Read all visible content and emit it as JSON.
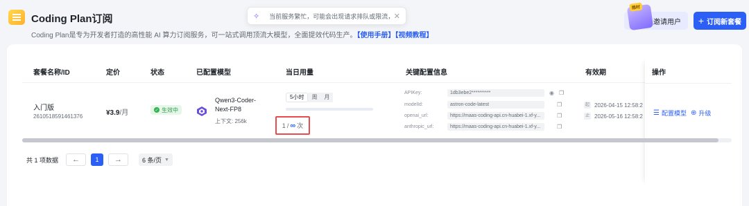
{
  "header": {
    "title": "Coding Plan订阅",
    "subtitle": "Coding Plan是专为开发者打造的高性能 AI 算力订阅服务，可一站式调用顶流大模型，全面提效代码生产。",
    "link_manual": "【使用手册】",
    "link_video": "【视频教程】",
    "invite_label": "邀请用户",
    "invite_badge": "限时",
    "subscribe_label": "订阅新套餐"
  },
  "toast": {
    "message": "当前服务繁忙，可能会出现请求排队或限流，GLM-"
  },
  "table": {
    "headers": [
      "套餐名称/ID",
      "定价",
      "状态",
      "已配置模型",
      "当日用量",
      "关键配置信息",
      "有效期",
      "操作"
    ],
    "row": {
      "name": "入门版",
      "id": "2610518591461376",
      "price": "¥3.9",
      "price_unit": "/月",
      "status": "生效中",
      "model_name": "Qwen3-Coder-Next-FP8",
      "model_context": "上下文: 256k",
      "usage_tabs": [
        "5小时",
        "周",
        "月"
      ],
      "usage_active_tab": "5小时",
      "usage_fraction": 0,
      "usage_count": "1",
      "usage_sep": "/",
      "usage_limit_symbol": "∞",
      "usage_unit": "次",
      "config": [
        {
          "key": "APIKey:",
          "value": "1db3ebe2**********",
          "icons": [
            "eye-icon",
            "copy-icon"
          ]
        },
        {
          "key": "modelId:",
          "value": "astron-code-latest",
          "icons": [
            "copy-icon"
          ]
        },
        {
          "key": "openai_url:",
          "value": "https://maas-coding-api.cn-huabei-1.xf-y...",
          "icons": [
            "copy-icon"
          ]
        },
        {
          "key": "anthropic_url:",
          "value": "https://maas-coding-api.cn-huabei-1.xf-y...",
          "icons": [
            "copy-icon"
          ]
        }
      ],
      "valid_start_mark": "起",
      "valid_start": "2026-04-15 12:58:2",
      "valid_end_mark": "止",
      "valid_end": "2026-05-16 12:58:2",
      "op_configure": "配置模型",
      "op_upgrade": "升级"
    }
  },
  "pagination": {
    "total": "共 1 项数据",
    "current_page": "1",
    "prev": "←",
    "next": "→",
    "page_size": "6 条/页"
  },
  "colors": {
    "accent": "#2b5ff5",
    "status_green": "#2e9c4a",
    "highlight_red": "#e84b4b"
  }
}
